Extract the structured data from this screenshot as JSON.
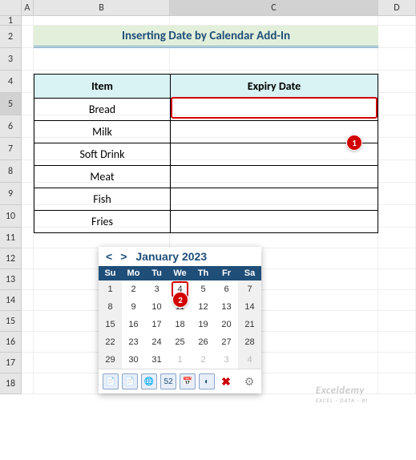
{
  "columns": [
    "A",
    "B",
    "C",
    "D"
  ],
  "rows": [
    "1",
    "2",
    "3",
    "4",
    "5",
    "6",
    "7",
    "8",
    "9",
    "10",
    "11",
    "12",
    "13",
    "14",
    "15",
    "16",
    "17",
    "18"
  ],
  "selected_col": "C",
  "selected_row": "5",
  "title": "Inserting Date by Calendar Add-In",
  "table": {
    "headers": {
      "item": "Item",
      "expiry": "Expiry Date"
    },
    "rows": [
      {
        "item": "Bread",
        "expiry": ""
      },
      {
        "item": "Milk",
        "expiry": ""
      },
      {
        "item": "Soft Drink",
        "expiry": ""
      },
      {
        "item": "Meat",
        "expiry": ""
      },
      {
        "item": "Fish",
        "expiry": ""
      },
      {
        "item": "Fries",
        "expiry": ""
      }
    ]
  },
  "callouts": {
    "one": "1",
    "two": "2"
  },
  "calendar": {
    "nav_prev": "<",
    "nav_next": ">",
    "title": "January 2023",
    "weekdays": [
      "Su",
      "Mo",
      "Tu",
      "We",
      "Th",
      "Fr",
      "Sa"
    ],
    "weeks": [
      [
        "1",
        "2",
        "3",
        "4",
        "5",
        "6",
        "7"
      ],
      [
        "8",
        "9",
        "10",
        "11",
        "12",
        "13",
        "14"
      ],
      [
        "15",
        "16",
        "17",
        "18",
        "19",
        "20",
        "21"
      ],
      [
        "22",
        "23",
        "24",
        "25",
        "26",
        "27",
        "28"
      ],
      [
        "29",
        "30",
        "31",
        "1",
        "2",
        "3",
        "4"
      ]
    ],
    "today_index": [
      0,
      3
    ],
    "dim_cells": [
      [
        4,
        3
      ],
      [
        4,
        4
      ],
      [
        4,
        5
      ],
      [
        4,
        6
      ]
    ],
    "tools": {
      "copy1": "📄",
      "copy2": "📄",
      "globe": "🌐",
      "week": "52",
      "cal": "📅",
      "moon": "◐",
      "close": "✖",
      "gear": "⚙"
    }
  },
  "watermark": {
    "main": "Exceldemy",
    "sub": "EXCEL · DATA · BI"
  }
}
